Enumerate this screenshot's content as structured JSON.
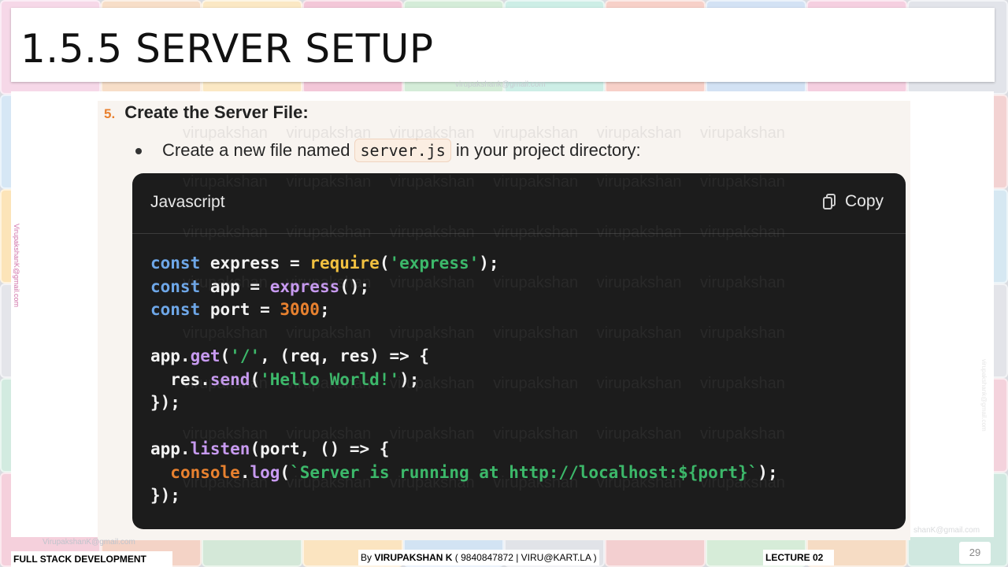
{
  "slide": {
    "title": "1.5.5 SERVER SETUP",
    "watermark_email": "virupakshank@gmail.com",
    "side_watermark": "VirupakshanK@gmail.com",
    "side_watermark_right": "virupakshank@gmail.com"
  },
  "content": {
    "step_number": "5.",
    "step_title": "Create the Server File:",
    "bullet_before": "Create a new file named",
    "bullet_code": "server.js",
    "bullet_after": "in your project directory:"
  },
  "code_block": {
    "language": "Javascript",
    "copy_label": "Copy",
    "watermark_word": "virupakshan"
  },
  "footer": {
    "course": "FULL STACK DEVELOPMENT",
    "by_prefix": "By ",
    "author": "VIRUPAKSHAN K",
    "contact": " ( 9840847872 | VIRU@KART.LA )",
    "lecture": "LECTURE 02",
    "page_number": "29",
    "footer_watermark": "VirupakshanK@gmail.com",
    "footer_watermark_right": "shanK@gmail.com"
  }
}
